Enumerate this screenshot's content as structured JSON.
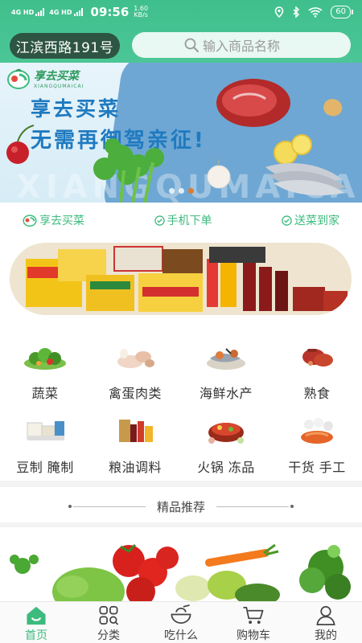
{
  "status_bar": {
    "signal1": "4G HD",
    "signal2": "4G HD",
    "time": "09:56",
    "speed": "1.60",
    "speed_unit": "KB/s",
    "battery": "60"
  },
  "header": {
    "address": "江滨西路191号",
    "search_placeholder": "输入商品名称"
  },
  "banner": {
    "brand": "享去买菜",
    "brand_sub": "XIANGQUMAICAI",
    "title_line1": "享去买菜",
    "title_line2": "无需再御驾亲征!",
    "watermark": "XIANGQUMAICAI",
    "slide_count": 3,
    "active_slide": 2
  },
  "features": [
    {
      "icon": "brand-logo-icon",
      "label": "享去买菜"
    },
    {
      "icon": "check-circle-icon",
      "label": "手机下单"
    },
    {
      "icon": "check-circle-icon",
      "label": "送菜到家"
    }
  ],
  "categories": [
    {
      "label": "蔬菜",
      "icon": "vegetables-icon"
    },
    {
      "label": "禽蛋肉类",
      "icon": "poultry-meat-icon"
    },
    {
      "label": "海鲜水产",
      "icon": "seafood-icon"
    },
    {
      "label": "熟食",
      "icon": "cooked-food-icon"
    },
    {
      "label": "豆制 腌制",
      "icon": "tofu-pickled-icon"
    },
    {
      "label": "粮油调料",
      "icon": "grain-oil-icon"
    },
    {
      "label": "火锅 冻品",
      "icon": "hotpot-frozen-icon"
    },
    {
      "label": "干货 手工",
      "icon": "dried-goods-icon"
    }
  ],
  "section": {
    "title": "精品推荐"
  },
  "tabs": [
    {
      "label": "首页",
      "icon": "home-icon",
      "active": true
    },
    {
      "label": "分类",
      "icon": "category-icon",
      "active": false
    },
    {
      "label": "吃什么",
      "icon": "bowl-icon",
      "active": false
    },
    {
      "label": "购物车",
      "icon": "cart-icon",
      "active": false
    },
    {
      "label": "我的",
      "icon": "user-icon",
      "active": false
    }
  ],
  "colors": {
    "primary": "#3dbb7e",
    "header_gradient_top": "#3fbf8b",
    "banner_title": "#1f7ac0",
    "slide_active": "#e07a2a"
  }
}
